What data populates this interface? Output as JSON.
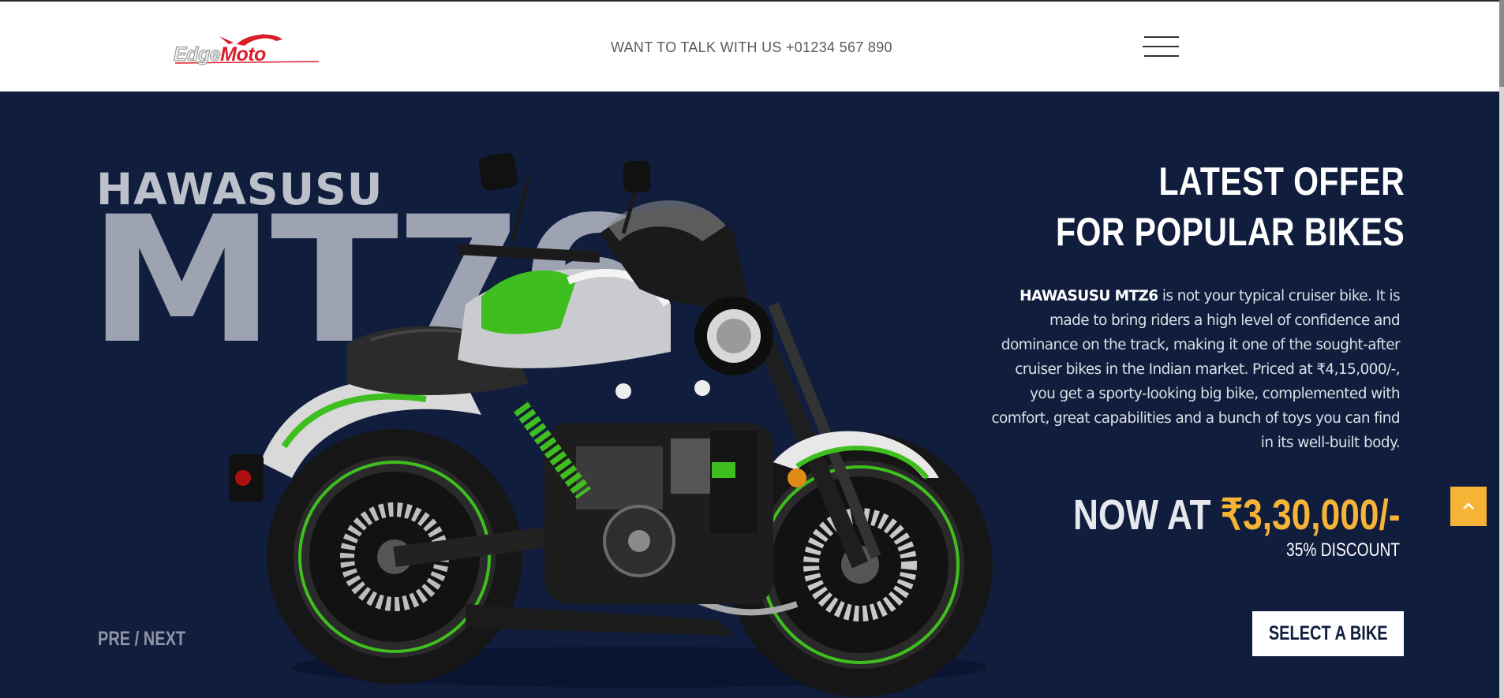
{
  "header": {
    "logo": {
      "part1": "Edge",
      "part2": "Moto"
    },
    "contact_text": "WANT TO TALK WITH US +01234 567 890",
    "menu_icon": "hamburger-menu-icon"
  },
  "hero": {
    "brand": "HAWASUSU",
    "model": "MT76",
    "offer_title": {
      "line1": "LATEST OFFER",
      "line2": "FOR POPULAR BIKES"
    },
    "description": {
      "highlight": "HAWASUSU MTZ6",
      "text": " is not your typical cruiser bike. It is made to bring riders a high level of confidence and dominance on the track, making it one of the sought-after cruiser bikes in the Indian market. Priced at ₹4,15,000/-, you get a sporty-looking big bike, complemented with comfort, great capabilities and a bunch of toys you can find in its well-built body."
    },
    "price": {
      "prefix": "NOW AT ",
      "amount": "₹3,30,000/-"
    },
    "discount": "35% DISCOUNT",
    "cta_label": "SELECT A BIKE",
    "nav": {
      "prev": "PRE",
      "separator": " / ",
      "next": "NEXT"
    },
    "image": "motorcycle-image",
    "back_to_top_icon": "chevron-up-icon"
  },
  "colors": {
    "hero_background": "#101d3d",
    "accent": "#f5b435",
    "logo_red": "#d91e2a",
    "bike_green": "#3fbf1f"
  }
}
